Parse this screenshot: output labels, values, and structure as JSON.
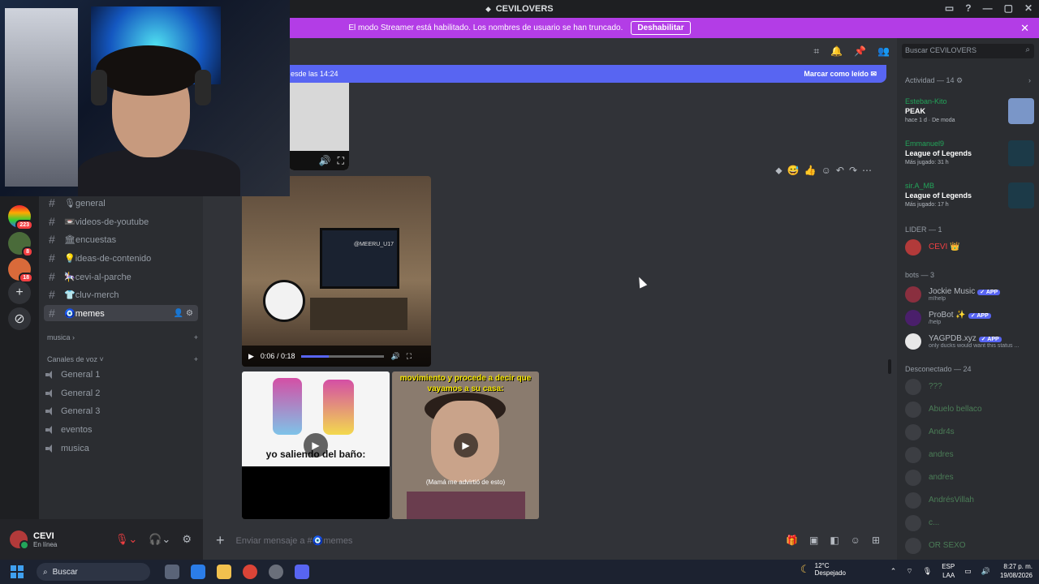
{
  "window": {
    "title": "CEVILOVERS"
  },
  "streamer_banner": {
    "text": "El modo Streamer está habilitado. Los nombres de usuario se han truncado.",
    "button": "Deshabilitar"
  },
  "channels": {
    "items": [
      {
        "label": "🎙general"
      },
      {
        "label": "📼videos-de-youtube"
      },
      {
        "label": "🏛encuestas"
      },
      {
        "label": "💡ideas-de-contenido"
      },
      {
        "label": "🎠cevi-al-parche"
      },
      {
        "label": "👕cluv-merch"
      },
      {
        "label": "🧿memes"
      }
    ],
    "category_music": "musica",
    "category_voice": "Canales de voz",
    "voice": [
      {
        "label": "General 1"
      },
      {
        "label": "General 2"
      },
      {
        "label": "General 3"
      },
      {
        "label": "eventos"
      },
      {
        "label": "musica"
      }
    ]
  },
  "servers": {
    "badges": [
      "223",
      "8",
      "18"
    ]
  },
  "user": {
    "name": "CEVI",
    "status": "En línea"
  },
  "new_messages": {
    "text": "esde las 14:24",
    "action": "Marcar como leído"
  },
  "video": {
    "time": "0:06 / 0:18",
    "progress": 0.33,
    "watermark": "@MEERU_U17"
  },
  "clips": {
    "caption_a": "yo saliendo del baño:",
    "caption_b": "movimiento y procede a decir que vayamos a su casa:",
    "subtitle_b": "(Mamá me advirtió de esto)"
  },
  "composer": {
    "placeholder": "Enviar mensaje a #🧿memes"
  },
  "members": {
    "search_placeholder": "Buscar CEVILOVERS",
    "activity_header": "Actividad — 14",
    "activity": [
      {
        "user": "Esteban-Kito",
        "game": "PEAK",
        "meta": "hace 1 d · De moda",
        "thumb_color": "#7a96c8"
      },
      {
        "user": "Emmanuel9",
        "game": "League of Legends",
        "meta": "Más jugado: 31 h",
        "thumb_color": "#1c3a48"
      },
      {
        "user": "sir.A_MB",
        "game": "League of Legends",
        "meta": "Más jugado: 17 h",
        "thumb_color": "#1c3a48"
      }
    ],
    "leader_header": "LIDER — 1",
    "leader": {
      "name": "CEVI 👑",
      "color": "#f23f42"
    },
    "bots_header": "bots — 3",
    "bots": [
      {
        "name": "Jockie Music",
        "sub": "m!help",
        "tag": "APP",
        "color": "#b5bac1"
      },
      {
        "name": "ProBot ✨",
        "sub": "/help",
        "tag": "APP",
        "color": "#b5bac1"
      },
      {
        "name": "YAGPDB.xyz",
        "sub": "only ducks would want this status ...",
        "tag": "APP",
        "color": "#b5bac1"
      }
    ],
    "offline_header": "Desconectado — 24",
    "offline": [
      {
        "name": "???"
      },
      {
        "name": "Abuelo bellaco"
      },
      {
        "name": "Andr4s"
      },
      {
        "name": "andres"
      },
      {
        "name": "andres"
      },
      {
        "name": "AndrésVillah"
      },
      {
        "name": "c..."
      },
      {
        "name": "OR SEXO"
      }
    ]
  },
  "taskbar": {
    "search": "Buscar",
    "weather_temp": "12°C",
    "weather_desc": "Despejado",
    "lang": "ESP",
    "lang2": "LAA",
    "time": "8:27 p. m.",
    "date": "19/08/2026"
  }
}
